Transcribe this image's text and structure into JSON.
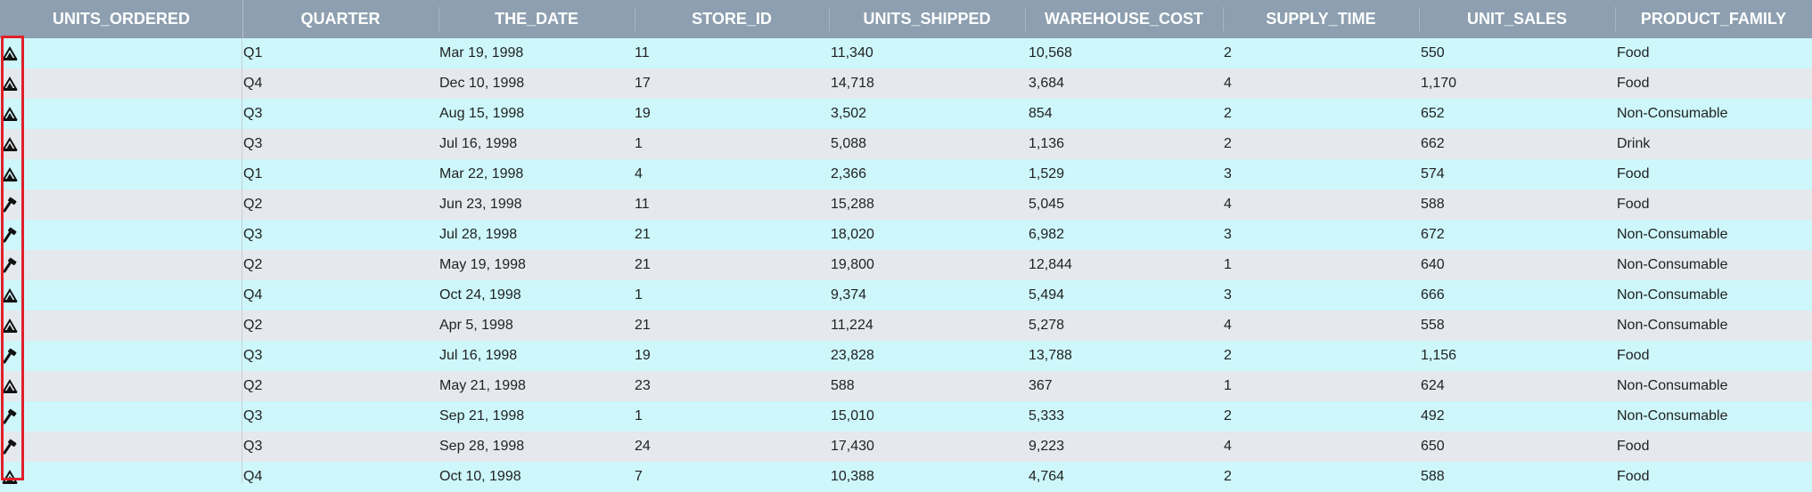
{
  "columns": [
    "UNITS_ORDERED",
    "QUARTER",
    "THE_DATE",
    "STORE_ID",
    "UNITS_SHIPPED",
    "WAREHOUSE_COST",
    "SUPPLY_TIME",
    "UNIT_SALES",
    "PRODUCT_FAMILY"
  ],
  "rows": [
    {
      "icon": "measure-icon",
      "cells": [
        "Q1",
        "Mar 19, 1998",
        "11",
        "11,340",
        "10,568",
        "2",
        "550",
        "Food"
      ]
    },
    {
      "icon": "measure-icon",
      "cells": [
        "Q4",
        "Dec 10, 1998",
        "17",
        "14,718",
        "3,684",
        "4",
        "1,170",
        "Food"
      ]
    },
    {
      "icon": "measure-icon",
      "cells": [
        "Q3",
        "Aug 15, 1998",
        "19",
        "3,502",
        "854",
        "2",
        "652",
        "Non-Consumable"
      ]
    },
    {
      "icon": "measure-icon",
      "cells": [
        "Q3",
        "Jul 16, 1998",
        "1",
        "5,088",
        "1,136",
        "2",
        "662",
        "Drink"
      ]
    },
    {
      "icon": "measure-icon",
      "cells": [
        "Q1",
        "Mar 22, 1998",
        "4",
        "2,366",
        "1,529",
        "3",
        "574",
        "Food"
      ]
    },
    {
      "icon": "hammer-icon",
      "cells": [
        "Q2",
        "Jun 23, 1998",
        "11",
        "15,288",
        "5,045",
        "4",
        "588",
        "Food"
      ]
    },
    {
      "icon": "hammer-icon",
      "cells": [
        "Q3",
        "Jul 28, 1998",
        "21",
        "18,020",
        "6,982",
        "3",
        "672",
        "Non-Consumable"
      ]
    },
    {
      "icon": "hammer-icon",
      "cells": [
        "Q2",
        "May 19, 1998",
        "21",
        "19,800",
        "12,844",
        "1",
        "640",
        "Non-Consumable"
      ]
    },
    {
      "icon": "measure-icon",
      "cells": [
        "Q4",
        "Oct 24, 1998",
        "1",
        "9,374",
        "5,494",
        "3",
        "666",
        "Non-Consumable"
      ]
    },
    {
      "icon": "measure-icon",
      "cells": [
        "Q2",
        "Apr 5, 1998",
        "21",
        "11,224",
        "5,278",
        "4",
        "558",
        "Non-Consumable"
      ]
    },
    {
      "icon": "hammer-icon",
      "cells": [
        "Q3",
        "Jul 16, 1998",
        "19",
        "23,828",
        "13,788",
        "2",
        "1,156",
        "Food"
      ]
    },
    {
      "icon": "measure-icon",
      "cells": [
        "Q2",
        "May 21, 1998",
        "23",
        "588",
        "367",
        "1",
        "624",
        "Non-Consumable"
      ]
    },
    {
      "icon": "hammer-icon",
      "cells": [
        "Q3",
        "Sep 21, 1998",
        "1",
        "15,010",
        "5,333",
        "2",
        "492",
        "Non-Consumable"
      ]
    },
    {
      "icon": "hammer-icon",
      "cells": [
        "Q3",
        "Sep 28, 1998",
        "24",
        "17,430",
        "9,223",
        "4",
        "650",
        "Food"
      ]
    },
    {
      "icon": "measure-icon",
      "cells": [
        "Q4",
        "Oct 10, 1998",
        "7",
        "10,388",
        "4,764",
        "2",
        "588",
        "Food"
      ]
    }
  ],
  "colors": {
    "header_bg": "#8d9fb0",
    "row_odd": "#cdf7fb",
    "row_even": "#e5e8ec",
    "highlight": "#e0202a"
  }
}
